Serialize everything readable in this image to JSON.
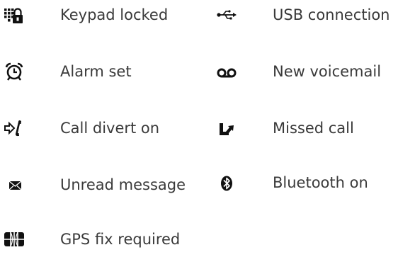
{
  "legend": {
    "left": [
      {
        "icon": "keypad-lock-icon",
        "label": "Keypad locked"
      },
      {
        "icon": "alarm-clock-icon",
        "label": "Alarm set"
      },
      {
        "icon": "call-divert-icon",
        "label": "Call divert on"
      },
      {
        "icon": "envelope-icon",
        "label": "Unread message"
      },
      {
        "icon": "gps-icon",
        "label": "GPS fix required"
      }
    ],
    "right": [
      {
        "icon": "usb-icon",
        "label": "USB connection"
      },
      {
        "icon": "voicemail-icon",
        "label": "New voicemail"
      },
      {
        "icon": "missed-call-icon",
        "label": "Missed call"
      },
      {
        "icon": "bluetooth-icon",
        "label": "Bluetooth on"
      }
    ]
  }
}
